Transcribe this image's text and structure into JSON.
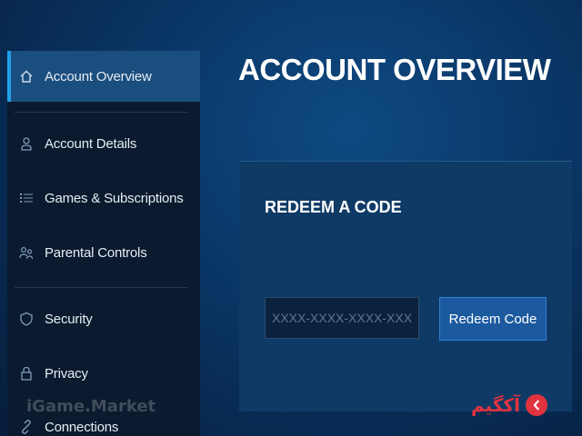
{
  "sidebar": {
    "items": [
      {
        "label": "Account Overview",
        "icon": "home-icon",
        "active": true
      },
      {
        "label": "Account Details",
        "icon": "user-icon"
      },
      {
        "label": "Games & Subscriptions",
        "icon": "list-icon"
      },
      {
        "label": "Parental Controls",
        "icon": "parental-icon"
      },
      {
        "label": "Security",
        "icon": "shield-icon"
      },
      {
        "label": "Privacy",
        "icon": "lock-icon"
      },
      {
        "label": "Connections",
        "icon": "link-icon"
      }
    ]
  },
  "main": {
    "title": "ACCOUNT OVERVIEW",
    "redeem": {
      "title": "REDEEM A CODE",
      "placeholder": "XXXX-XXXX-XXXX-XXXX",
      "button_label": "Redeem Code"
    }
  },
  "watermarks": {
    "left": "iGame.Market",
    "right": "آکگیم"
  },
  "colors": {
    "accent": "#1fa0e8",
    "active_item": "#1a4e7e",
    "button": "#1c5aa0",
    "watermark_brand": "#e0333f"
  }
}
